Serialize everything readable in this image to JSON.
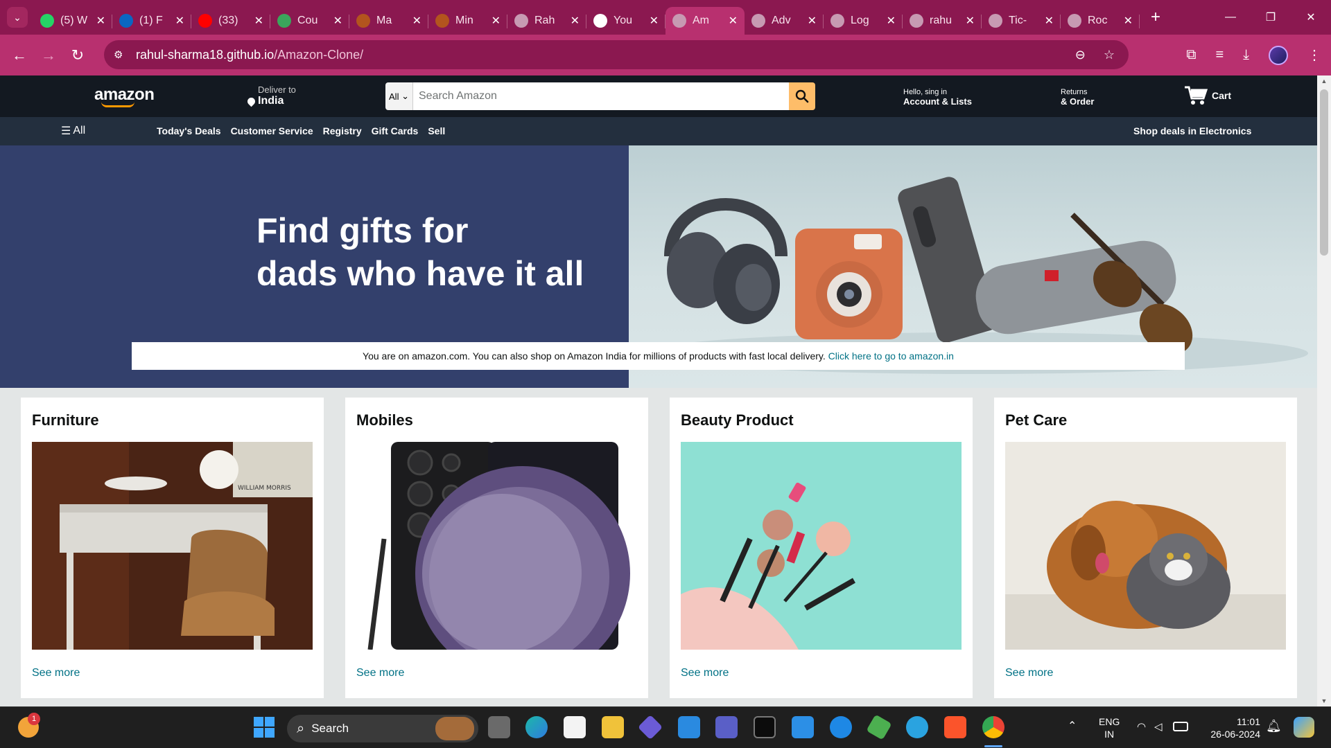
{
  "browser": {
    "tabs": [
      {
        "title": "(5) W",
        "icon": "whatsapp-icon",
        "color": "#25d366"
      },
      {
        "title": "(1) F",
        "icon": "linkedin-icon",
        "color": "#0a66c2"
      },
      {
        "title": "(33)",
        "icon": "youtube-icon",
        "color": "#ff0000"
      },
      {
        "title": "Cou",
        "icon": "course-icon",
        "color": "#3ba55c"
      },
      {
        "title": "Ma",
        "icon": "chatbot-icon",
        "color": "#b3541e"
      },
      {
        "title": "Min",
        "icon": "chatbot-icon",
        "color": "#b3541e"
      },
      {
        "title": "Rah",
        "icon": "globe-icon",
        "color": "#c79ab2"
      },
      {
        "title": "You",
        "icon": "github-icon",
        "color": "#ffffff"
      },
      {
        "title": "Am",
        "icon": "globe-icon",
        "color": "#c79ab2",
        "active": true
      },
      {
        "title": "Adv",
        "icon": "globe-icon",
        "color": "#c79ab2"
      },
      {
        "title": "Log",
        "icon": "globe-icon",
        "color": "#c79ab2"
      },
      {
        "title": "rahu",
        "icon": "globe-icon",
        "color": "#c79ab2"
      },
      {
        "title": "Tic-",
        "icon": "globe-icon",
        "color": "#c79ab2"
      },
      {
        "title": "Roc",
        "icon": "globe-icon",
        "color": "#c79ab2"
      }
    ],
    "url_host": "rahul-sharma18.github.io",
    "url_path": "/Amazon-Clone/"
  },
  "amazon": {
    "logo": "amazon",
    "deliver_line1": "Deliver to",
    "deliver_line2": "India",
    "search_category": "All",
    "search_placeholder": "Search Amazon",
    "account_line1": "Hello, sing in",
    "account_line2": "Account & Lists",
    "returns_line1": "Returns",
    "returns_line2": "& Order",
    "cart_label": "Cart",
    "subnav": {
      "all_label": "All",
      "links": [
        "Today's Deals",
        "Customer Service",
        "Registry",
        "Gift Cards",
        "Sell"
      ],
      "right_label": "Shop deals in Electronics"
    },
    "hero": {
      "line1": "Find gifts for",
      "line2": "dads who have it all"
    },
    "notice": {
      "text": "You are on amazon.com. You can also shop on Amazon India for millions of products with fast local delivery. ",
      "link": "Click here to go to amazon.in"
    },
    "cards": [
      {
        "title": "Furniture",
        "link": "See more"
      },
      {
        "title": "Mobiles",
        "link": "See more"
      },
      {
        "title": "Beauty Product",
        "link": "See more"
      },
      {
        "title": "Pet Care",
        "link": "See more"
      }
    ],
    "colors": {
      "header": "#131921",
      "subnav": "#232f3e",
      "accent": "#febd69",
      "link": "#007185"
    }
  },
  "taskbar": {
    "search_label": "Search",
    "weather_badge": "1",
    "lang_line1": "ENG",
    "lang_line2": "IN",
    "time": "11:01",
    "date": "26-06-2024"
  }
}
